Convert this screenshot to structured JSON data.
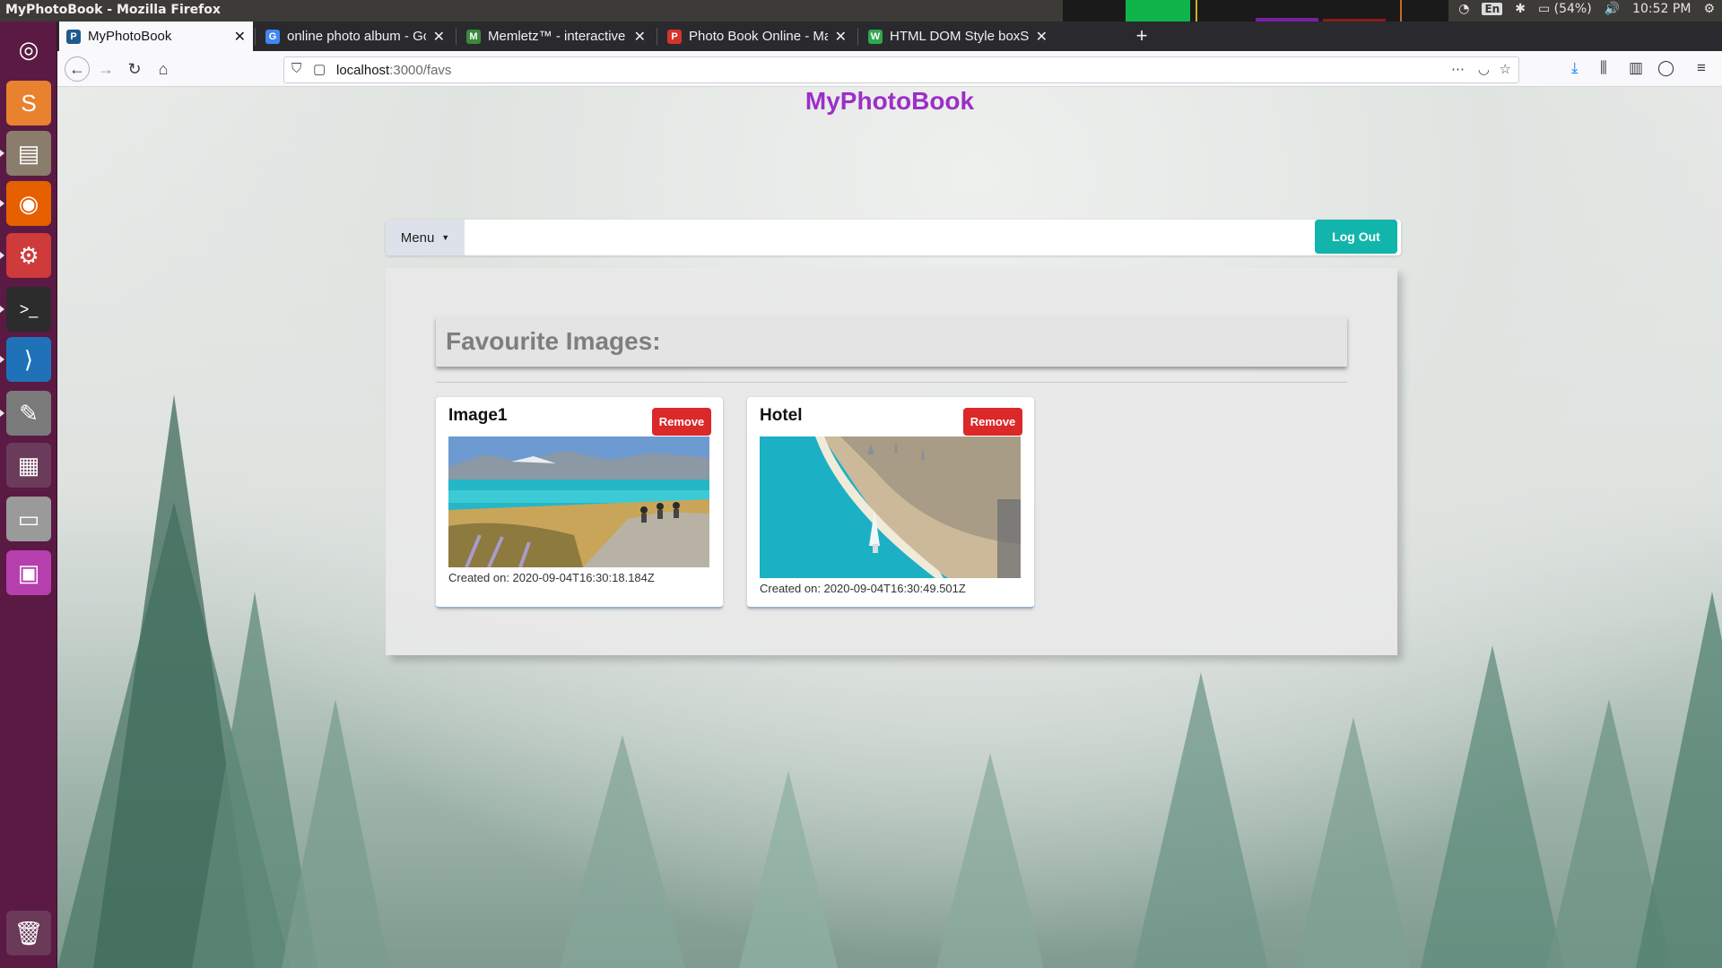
{
  "system": {
    "window_title": "MyPhotoBook - Mozilla Firefox",
    "keyboard_lang": "En",
    "battery": "(54%)",
    "clock": "10:52 PM"
  },
  "launcher": {
    "items": [
      {
        "name": "ubuntu-dash-icon",
        "glyph": "◎",
        "color": "#5a1a43"
      },
      {
        "name": "sublime-text-icon",
        "glyph": "S",
        "color": "#e8822f"
      },
      {
        "name": "files-icon",
        "glyph": "▤",
        "color": "#8b7d6b"
      },
      {
        "name": "firefox-icon",
        "glyph": "◉",
        "color": "#e66000"
      },
      {
        "name": "system-settings-icon",
        "glyph": "⚙",
        "color": "#cf3a3a"
      },
      {
        "name": "terminal-icon",
        "glyph": ">_",
        "color": "#2c2c2c"
      },
      {
        "name": "vscode-icon",
        "glyph": "⟩",
        "color": "#1f72b8"
      },
      {
        "name": "text-editor-icon",
        "glyph": "✎",
        "color": "#7a7a7a"
      },
      {
        "name": "workspace-switcher-icon",
        "glyph": "▦",
        "color": "#6b3b5c"
      },
      {
        "name": "drive-icon",
        "glyph": "▭",
        "color": "#9a9a9a"
      },
      {
        "name": "app-window-icon",
        "glyph": "▣",
        "color": "#b63fae"
      }
    ],
    "trash": {
      "name": "trash-icon",
      "glyph": "🗑"
    }
  },
  "browser": {
    "tabs": [
      {
        "label": "MyPhotoBook",
        "favicon": "P",
        "favicon_color": "#1e5a8c",
        "active": true
      },
      {
        "label": "online photo album - Go",
        "favicon": "G",
        "favicon_color": "#4285f4",
        "active": false
      },
      {
        "label": "Memletz™ - interactive c",
        "favicon": "M",
        "favicon_color": "#3a8a3a",
        "active": false
      },
      {
        "label": "Photo Book Online - Ma",
        "favicon": "P",
        "favicon_color": "#d6332b",
        "active": false
      },
      {
        "label": "HTML DOM Style boxSh",
        "favicon": "W",
        "favicon_color": "#2fa84f",
        "active": false
      }
    ],
    "url": {
      "host": "localhost",
      "path": ":3000/favs"
    }
  },
  "app": {
    "brand": "MyPhotoBook",
    "menu_label": "Menu",
    "logout_label": "Log Out",
    "section_title": "Favourite Images:",
    "remove_label": "Remove",
    "cards": [
      {
        "title": "Image1",
        "created": "Created on: 2020-09-04T16:30:18.184Z",
        "image": "lake-bike-photo"
      },
      {
        "title": "Hotel",
        "created": "Created on: 2020-09-04T16:30:49.501Z",
        "image": "dubai-coast-photo"
      }
    ]
  },
  "colors": {
    "brand": "#9b2fc9",
    "logout": "#12b5ab",
    "remove": "#db2828",
    "launcher": "#5a1a43"
  }
}
